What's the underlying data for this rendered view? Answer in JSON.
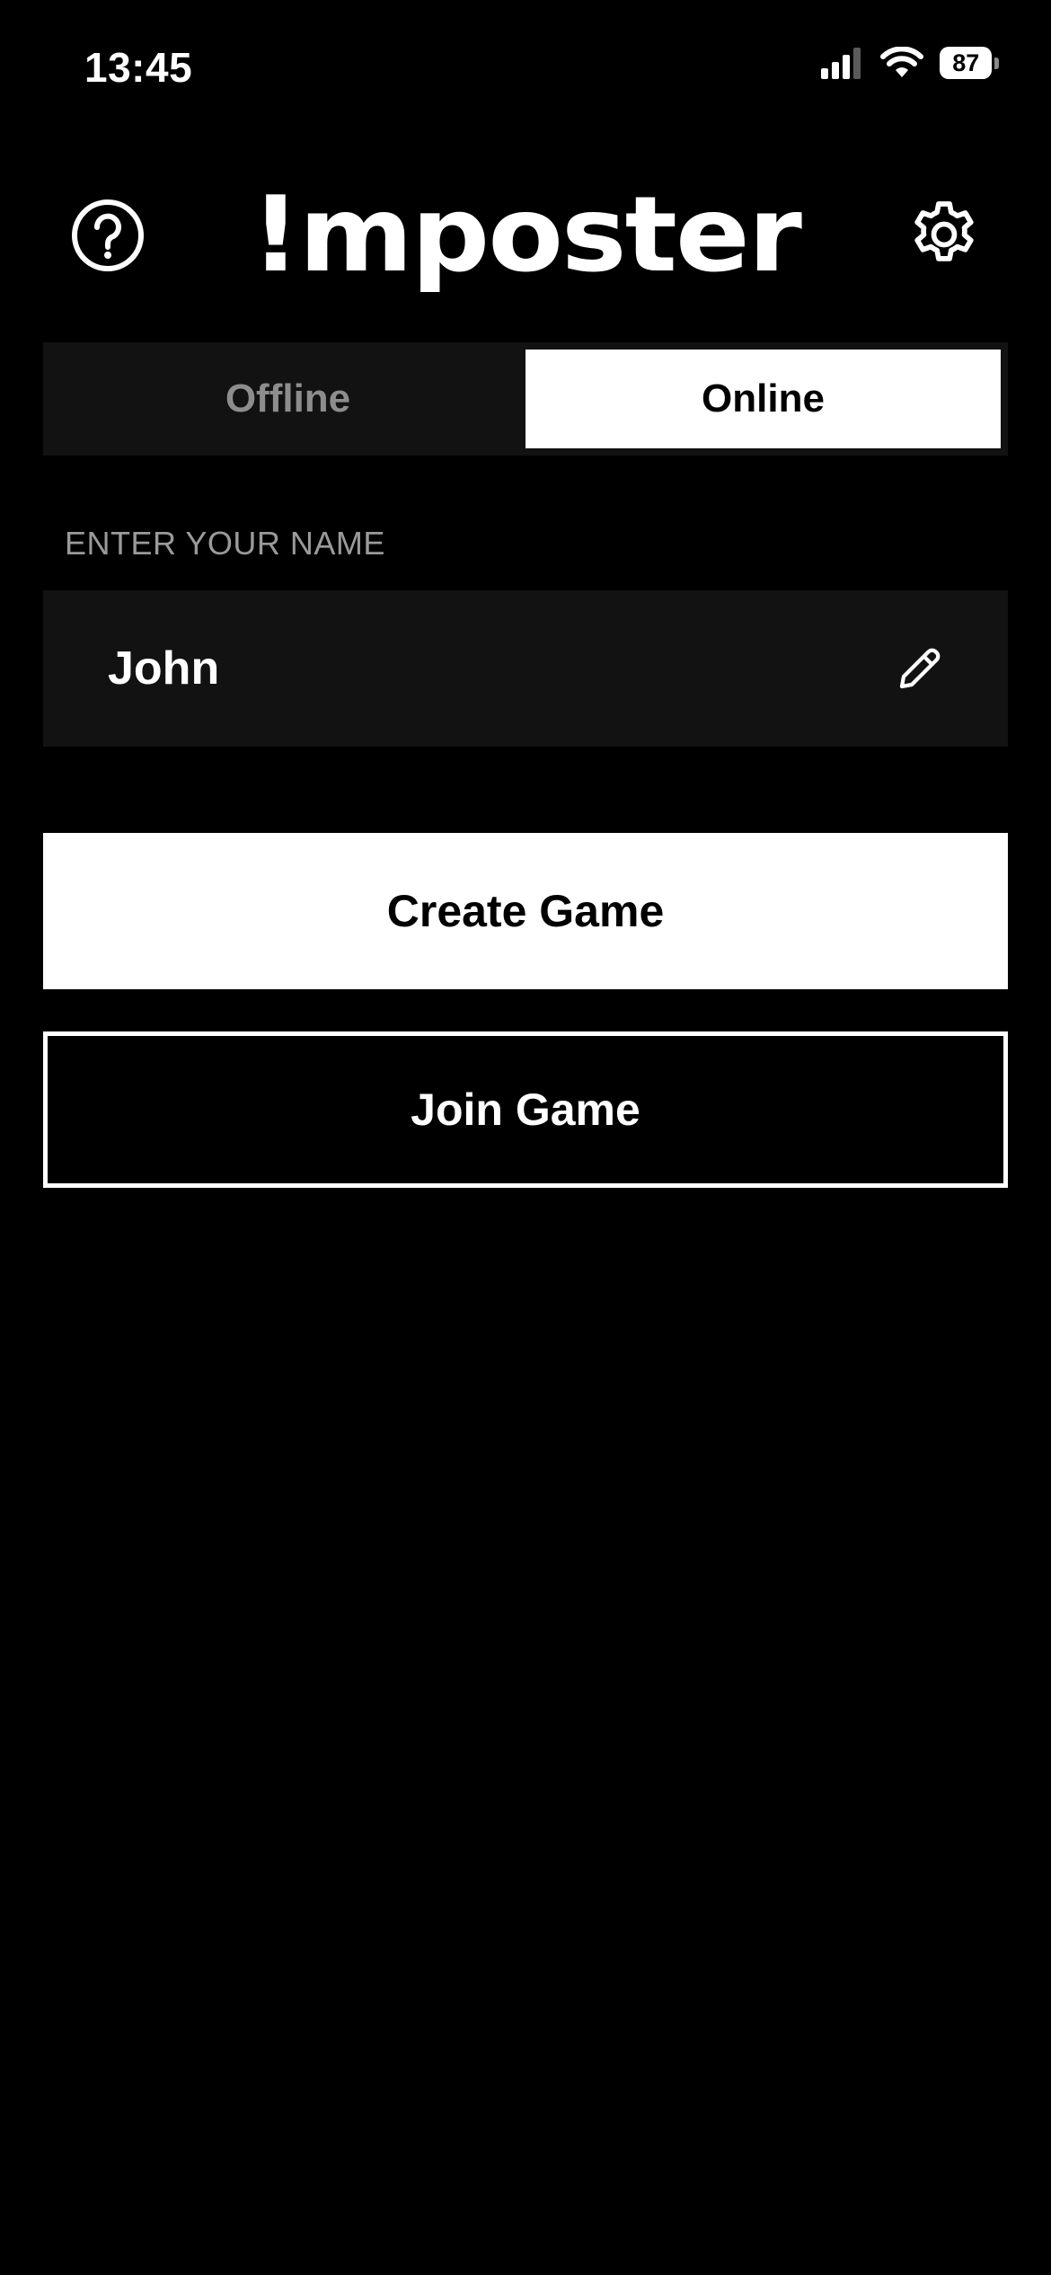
{
  "status_bar": {
    "time": "13:45",
    "battery": "87",
    "icons": [
      "cellular-signal-icon",
      "wifi-icon",
      "battery-icon"
    ]
  },
  "header": {
    "logo": "!mposter",
    "help_icon": "question-circle-icon",
    "settings_icon": "gear-icon"
  },
  "mode_toggle": {
    "tabs": [
      {
        "label": "Offline",
        "selected": false
      },
      {
        "label": "Online",
        "selected": true
      }
    ]
  },
  "name_section": {
    "label": "ENTER YOUR NAME",
    "value": "John",
    "edit_icon": "pencil-icon"
  },
  "actions": {
    "create_label": "Create Game",
    "join_label": "Join Game"
  },
  "colors": {
    "background": "#000000",
    "surface": "#121212",
    "primary": "#ffffff",
    "muted_text": "#8d8d8d"
  }
}
